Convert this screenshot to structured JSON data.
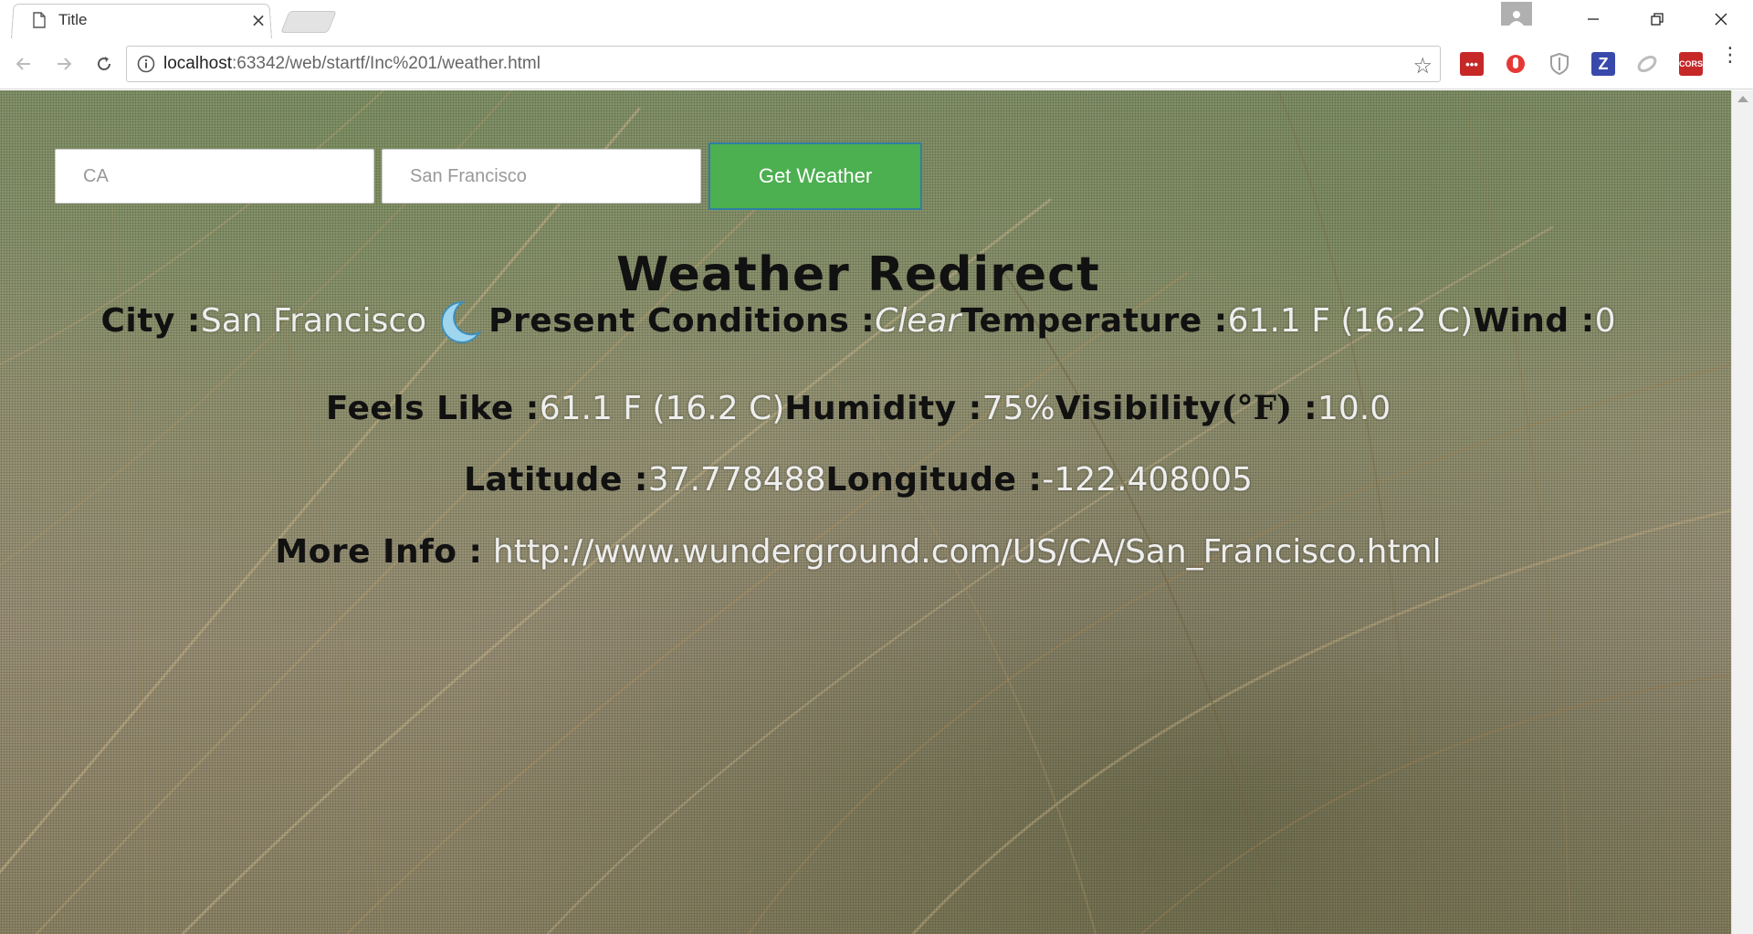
{
  "browser": {
    "tab_title": "Title",
    "tab_close": "×",
    "url_host": "localhost",
    "url_rest": ":63342/web/startf/Inc%201/weather.html",
    "extensions": [
      {
        "name": "lastpass-extension",
        "label": "•••",
        "color": "#c62828"
      },
      {
        "name": "adblock-extension",
        "label": "",
        "color": "#e53935"
      },
      {
        "name": "shield-extension",
        "label": "",
        "color": "#9e9e9e"
      },
      {
        "name": "zotero-extension",
        "label": "Z",
        "color": "#3949ab"
      },
      {
        "name": "leaf-extension",
        "label": "",
        "color": "#bdbdbd"
      },
      {
        "name": "cors-extension",
        "label": "CORS",
        "color": "#c62828"
      }
    ]
  },
  "form": {
    "state_value": "CA",
    "city_value": "San Francisco",
    "button_label": "Get Weather"
  },
  "page": {
    "heading": "Weather Redirect"
  },
  "weather": {
    "city_label": "City :",
    "city_value": "San Francisco",
    "conditions_label": "Present Conditions :",
    "conditions_value": "Clear",
    "temperature_label": "Temperature :",
    "temperature_value": "61.1 F (16.2 C)",
    "wind_label": "Wind :",
    "wind_value": "0",
    "feels_like_label": "Feels Like :",
    "feels_like_value": "61.1 F (16.2 C)",
    "humidity_label": "Humidity :",
    "humidity_value": "75%",
    "visibility_label": "Visibility",
    "visibility_unit": "(°F)",
    "visibility_colon": " :",
    "visibility_value": "10.0",
    "latitude_label": "Latitude :",
    "latitude_value": "37.778488",
    "longitude_label": "Longitude :",
    "longitude_value": "-122.408005",
    "more_info_label": "More Info :",
    "more_info_url": "http://www.wunderground.com/US/CA/San_Francisco.html"
  },
  "colors": {
    "button_green": "#4caf50",
    "value_text": "#eeeeee",
    "label_text": "#111111"
  }
}
